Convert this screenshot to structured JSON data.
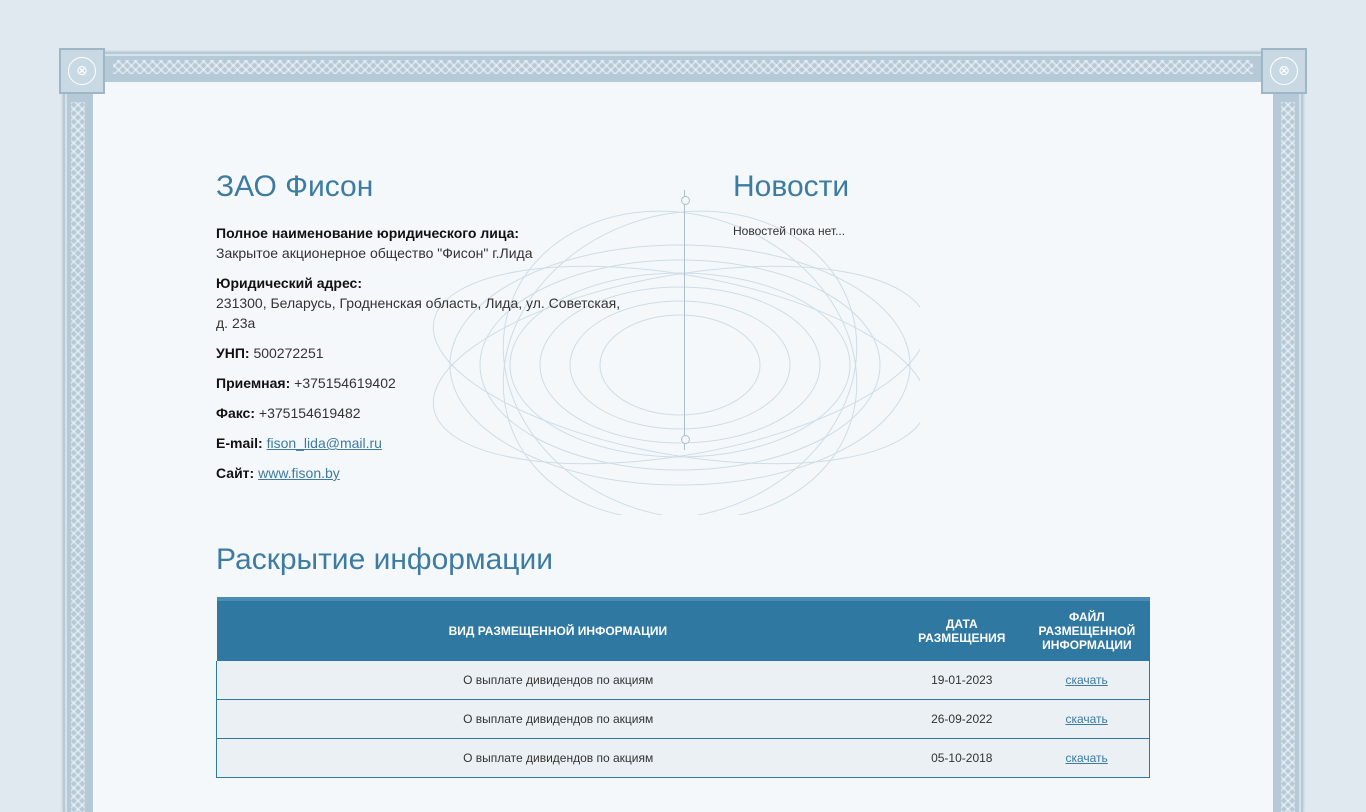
{
  "company": {
    "title": "ЗАО Фисон",
    "full_name_label": "Полное наименование юридического лица:",
    "full_name": "Закрытое акционерное общество \"Фисон\" г.Лида",
    "address_label": "Юридический адрес:",
    "address": "231300, Беларусь, Гродненская область, Лида, ул. Советская, д. 23а",
    "unp_label": "УНП:",
    "unp": "500272251",
    "reception_label": "Приемная:",
    "reception": "+375154619402",
    "fax_label": "Факс:",
    "fax": "+375154619482",
    "email_label": "E-mail:",
    "email": "fison_lida@mail.ru",
    "site_label": "Сайт:",
    "site": "www.fison.by"
  },
  "news": {
    "title": "Новости",
    "empty_text": "Новостей пока нет..."
  },
  "disclosure": {
    "title": "Раскрытие информации",
    "columns": {
      "type": "ВИД РАЗМЕЩЕННОЙ ИНФОРМАЦИИ",
      "date": "ДАТА РАЗМЕЩЕНИЯ",
      "file": "ФАЙЛ РАЗМЕЩЕННОЙ ИНФОРМАЦИИ"
    },
    "rows": [
      {
        "type": "О выплате дивидендов по акциям",
        "date": "19-01-2023",
        "file": "скачать"
      },
      {
        "type": "О выплате дивидендов по акциям",
        "date": "26-09-2022",
        "file": "скачать"
      },
      {
        "type": "О выплате дивидендов по акциям",
        "date": "05-10-2018",
        "file": "скачать"
      }
    ]
  },
  "colors": {
    "accent": "#3e7ba1",
    "table_header": "#2f78a2",
    "frame": "#b5c9d7"
  }
}
